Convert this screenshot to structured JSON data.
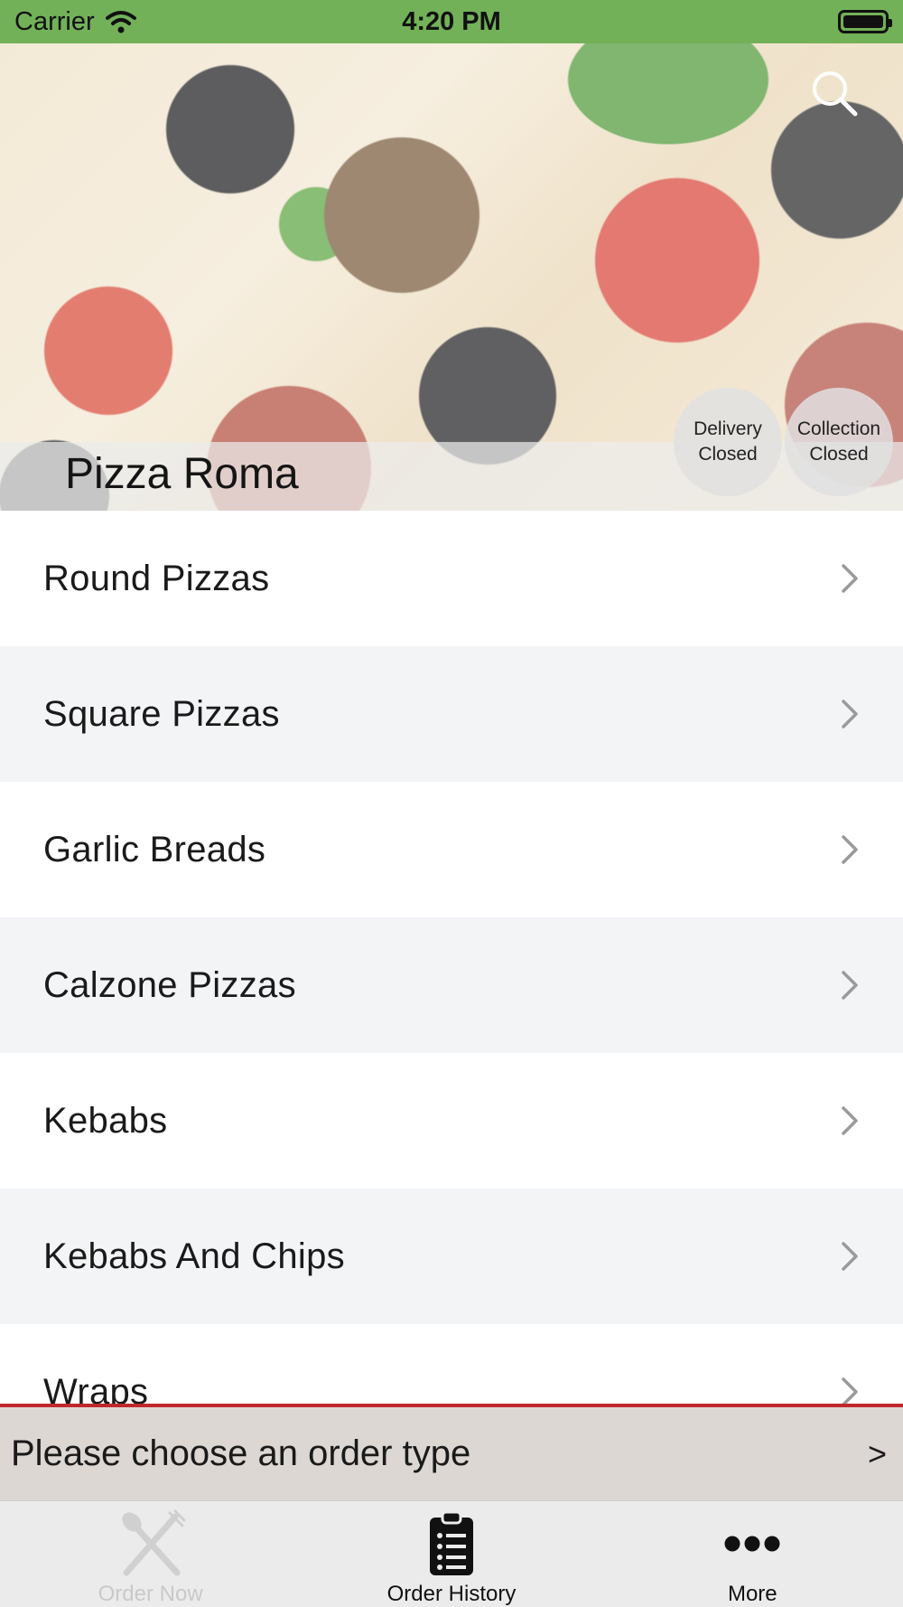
{
  "status_bar": {
    "carrier": "Carrier",
    "time": "4:20 PM"
  },
  "hero": {
    "restaurant_name": "Pizza Roma",
    "delivery_status_line1": "Delivery",
    "delivery_status_line2": "Closed",
    "collection_status_line1": "Collection",
    "collection_status_line2": "Closed"
  },
  "categories": [
    {
      "label": "Round Pizzas"
    },
    {
      "label": "Square Pizzas"
    },
    {
      "label": "Garlic Breads"
    },
    {
      "label": "Calzone Pizzas"
    },
    {
      "label": "Kebabs"
    },
    {
      "label": "Kebabs And Chips"
    },
    {
      "label": "Wraps"
    }
  ],
  "order_type_bar": {
    "text": "Please choose an order type",
    "arrow": ">"
  },
  "tab_bar": {
    "tabs": [
      {
        "label": "Order Now",
        "icon": "fork-knife-icon",
        "state": "disabled"
      },
      {
        "label": "Order History",
        "icon": "clipboard-list-icon",
        "state": "active"
      },
      {
        "label": "More",
        "icon": "more-dots-icon",
        "state": "active"
      }
    ]
  },
  "colors": {
    "status_bar_bg": "#72b158",
    "order_bar_accent": "#c1272d",
    "order_bar_bg": "#dcd7d3",
    "tab_bar_bg": "#ebebeb"
  }
}
